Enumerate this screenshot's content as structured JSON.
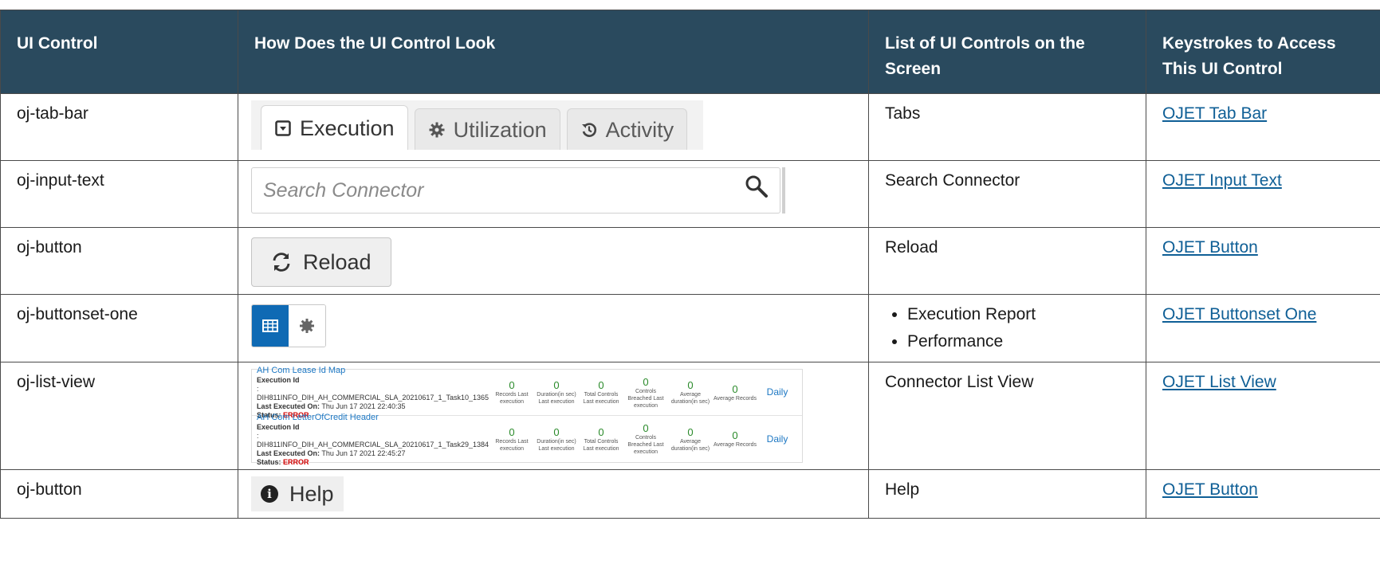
{
  "headers": {
    "ui_control": "UI Control",
    "look": "How Does the UI Control Look",
    "list": "List of UI Controls on the Screen",
    "keys": "Keystrokes to Access This UI Control"
  },
  "rows": [
    {
      "control": "oj-tab-bar",
      "list": "Tabs",
      "link": "OJET Tab Bar"
    },
    {
      "control": "oj-input-text",
      "list": "Search Connector",
      "link": "OJET Input Text"
    },
    {
      "control": "oj-button",
      "list": "Reload",
      "link": "OJET Button"
    },
    {
      "control": "oj-buttonset-one",
      "list_items": [
        "Execution Report",
        "Performance"
      ],
      "link": "OJET Buttonset One"
    },
    {
      "control": "oj-list-view",
      "list": "Connector List View",
      "link": "OJET List View"
    },
    {
      "control": "oj-button",
      "list": "Help",
      "link": "OJET Button"
    }
  ],
  "tabbar": {
    "tabs": [
      {
        "label": "Execution",
        "icon": "caret-square-icon",
        "active": true
      },
      {
        "label": "Utilization",
        "icon": "gear-icon",
        "active": false
      },
      {
        "label": "Activity",
        "icon": "history-icon",
        "active": false
      }
    ]
  },
  "search": {
    "placeholder": "Search Connector",
    "icon": "search-icon"
  },
  "reload": {
    "label": "Reload",
    "icon": "refresh-icon"
  },
  "buttonset": {
    "buttons": [
      {
        "icon": "table-icon",
        "selected": true
      },
      {
        "icon": "gear-icon",
        "selected": false
      }
    ]
  },
  "listview": {
    "labels": {
      "execution_id": "Execution Id",
      "last_executed": "Last Executed On:",
      "status": "Status:"
    },
    "items": [
      {
        "name": "AH Com Lease Id Map",
        "execution_id": ": DIH811INFO_DIH_AH_COMMERCIAL_SLA_20210617_1_Task10_1365",
        "last_executed": "Thu Jun 17 2021 22:40:35",
        "status": "ERROR",
        "metrics": [
          {
            "value": "0",
            "caption": "Records Last execution"
          },
          {
            "value": "0",
            "caption": "Duration(in sec) Last execution"
          },
          {
            "value": "0",
            "caption": "Total Controls Last execution"
          },
          {
            "value": "0",
            "caption": "Controls Breached Last execution"
          },
          {
            "value": "0",
            "caption": "Average duration(in sec)"
          },
          {
            "value": "0",
            "caption": "Average Records"
          }
        ],
        "frequency": "Daily"
      },
      {
        "name": "AH Com LetterOfCredit Header",
        "execution_id": ": DIH811INFO_DIH_AH_COMMERCIAL_SLA_20210617_1_Task29_1384",
        "last_executed": "Thu Jun 17 2021 22:45:27",
        "status": "ERROR",
        "metrics": [
          {
            "value": "0",
            "caption": "Records Last execution"
          },
          {
            "value": "0",
            "caption": "Duration(in sec) Last execution"
          },
          {
            "value": "0",
            "caption": "Total Controls Last execution"
          },
          {
            "value": "0",
            "caption": "Controls Breached Last execution"
          },
          {
            "value": "0",
            "caption": "Average duration(in sec)"
          },
          {
            "value": "0",
            "caption": "Average Records"
          }
        ],
        "frequency": "Daily"
      }
    ]
  },
  "help": {
    "label": "Help",
    "icon": "info-icon"
  },
  "colors": {
    "header_bg": "#2a4a5e",
    "link": "#0f5f96",
    "accent": "#0f6ab4",
    "error": "#d10000",
    "metric": "#2a8a2a"
  }
}
